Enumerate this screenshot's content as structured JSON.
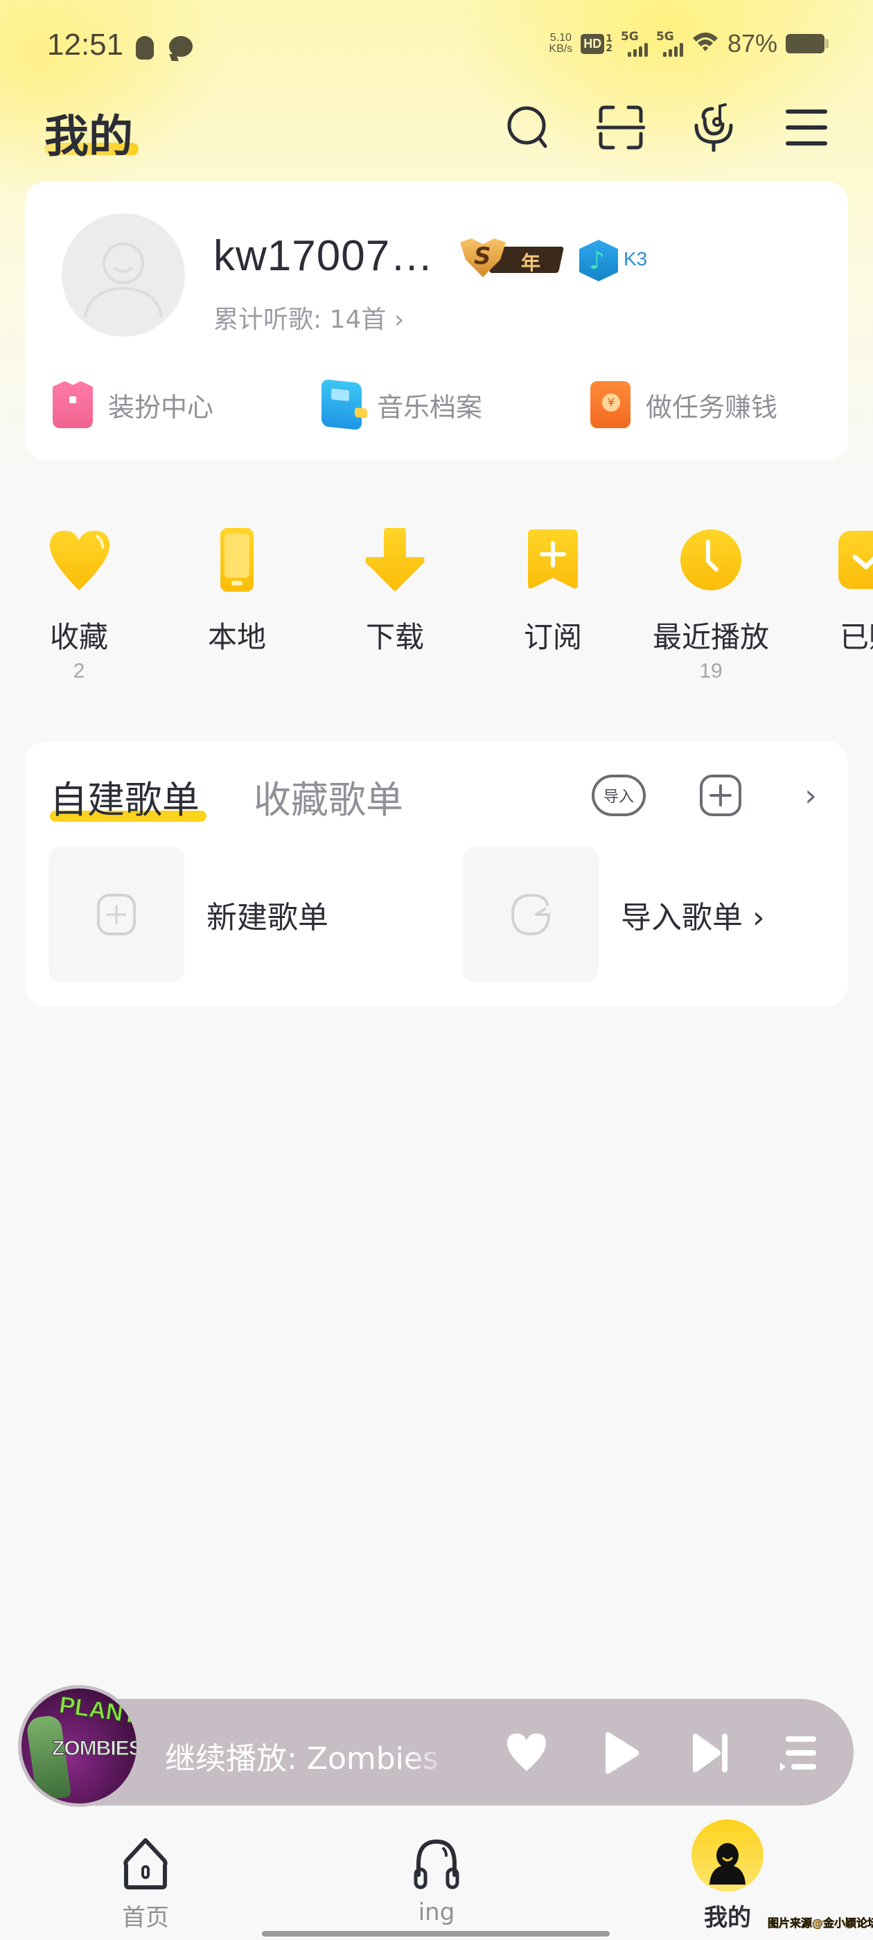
{
  "status_bar": {
    "time": "12:51",
    "net_speed_value": "5.10",
    "net_speed_unit": "KB/s",
    "hd_label": "HD",
    "hd_sub_top": "1",
    "hd_sub_bottom": "2",
    "sim1_label": "5G",
    "sim2_label": "5G",
    "battery_percent": "87%"
  },
  "header": {
    "title": "我的",
    "icons": [
      "search-icon",
      "scan-icon",
      "karaoke-mic-icon",
      "menu-icon"
    ]
  },
  "profile": {
    "username": "kw17007…",
    "vip_badge_letter": "S",
    "vip_badge_text": "年",
    "level_badge_text": "K3",
    "listen_count_label": "累计听歌: 14首 ›",
    "quick_links": [
      {
        "label": "装扮中心",
        "icon": "dress-up-icon"
      },
      {
        "label": "音乐档案",
        "icon": "music-archive-icon"
      },
      {
        "label": "做任务赚钱",
        "icon": "red-envelope-icon"
      }
    ]
  },
  "shortcuts": [
    {
      "label": "收藏",
      "count": "2",
      "icon": "heart-icon"
    },
    {
      "label": "本地",
      "count": "",
      "icon": "phone-icon"
    },
    {
      "label": "下载",
      "count": "",
      "icon": "download-icon"
    },
    {
      "label": "订阅",
      "count": "",
      "icon": "subscribe-icon"
    },
    {
      "label": "最近播放",
      "count": "19",
      "icon": "clock-icon"
    },
    {
      "label": "已购",
      "count": "",
      "icon": "purchased-icon"
    }
  ],
  "playlists": {
    "tabs": [
      {
        "label": "自建歌单",
        "active": true
      },
      {
        "label": "收藏歌单",
        "active": false
      }
    ],
    "import_button": "导入",
    "more_symbol": "›",
    "items": [
      {
        "label": "新建歌单",
        "icon": "plus-icon"
      },
      {
        "label": "导入歌单 ›",
        "icon": "import-icon"
      }
    ]
  },
  "mini_player": {
    "cover_title_top": "PLANTS",
    "cover_title_bottom": "ZOMBIES",
    "text": "继续播放: Zombies"
  },
  "bottom_nav": [
    {
      "label": "首页",
      "icon": "home-icon",
      "active": false
    },
    {
      "label": "ing",
      "icon": "headphones-icon",
      "active": false
    },
    {
      "label": "我的",
      "icon": "profile-icon",
      "active": true
    }
  ],
  "watermark": "图片来源@金小颖论坛",
  "colors": {
    "accent_yellow": "#fbd21c",
    "text_primary": "#2b2e36",
    "text_secondary": "#8f9198",
    "mini_player_bg": "#c7bec5"
  }
}
